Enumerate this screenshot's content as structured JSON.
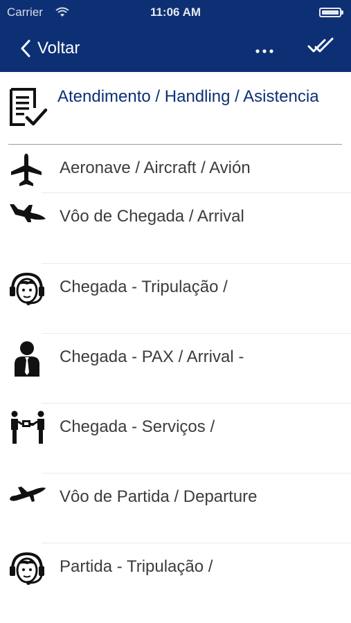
{
  "status_bar": {
    "carrier": "Carrier",
    "time": "11:06 AM"
  },
  "nav": {
    "back_label": "Voltar",
    "more_icon": "ellipsis-icon",
    "confirm_icon": "double-check-icon",
    "background_color": "#0d3075"
  },
  "header": {
    "title": "Atendimento / Handling / Asistencia",
    "icon": "checklist-document-icon",
    "title_color": "#0d3075"
  },
  "menu": {
    "items": [
      {
        "label": "Aeronave / Aircraft / Avión",
        "icon": "airplane-icon"
      },
      {
        "label": "Vôo de Chegada / Arrival",
        "icon": "landing-plane-icon"
      },
      {
        "label": "Chegada - Tripulação /",
        "icon": "headset-person-icon"
      },
      {
        "label": "Chegada - PAX / Arrival -",
        "icon": "passenger-icon"
      },
      {
        "label": "Chegada - Serviços /",
        "icon": "service-desk-icon"
      },
      {
        "label": "Vôo de Partida / Departure",
        "icon": "takeoff-plane-icon"
      },
      {
        "label": "Partida - Tripulação /",
        "icon": "headset-person-icon"
      }
    ]
  }
}
